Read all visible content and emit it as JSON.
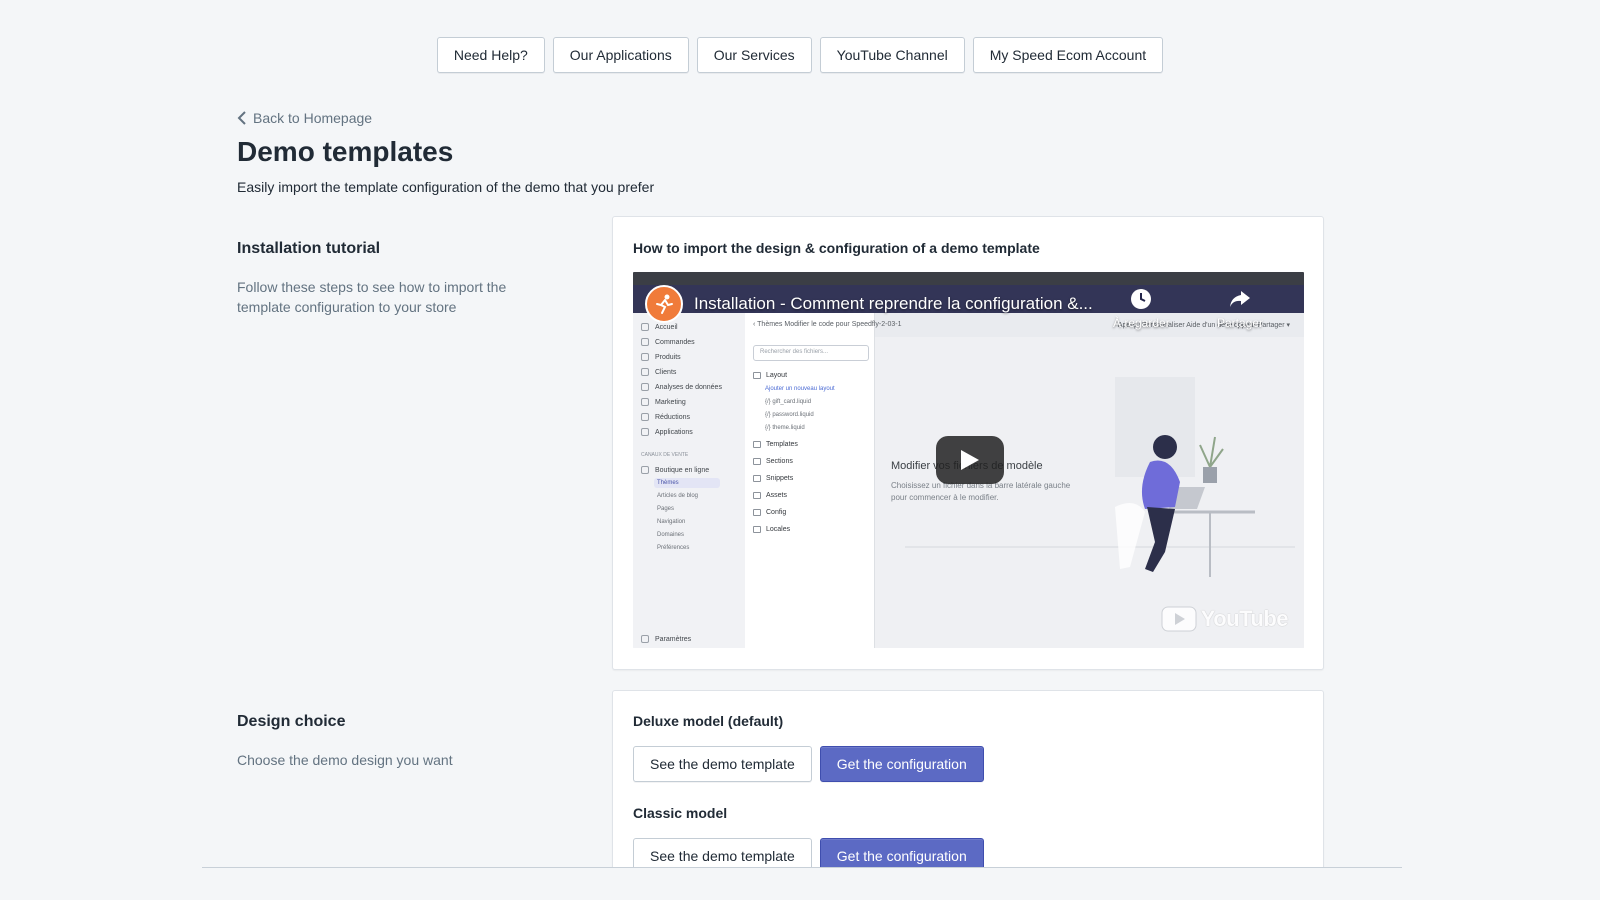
{
  "topnav": {
    "items": [
      "Need Help?",
      "Our Applications",
      "Our Services",
      "YouTube Channel",
      "My Speed Ecom Account"
    ]
  },
  "back": {
    "label": "Back to Homepage"
  },
  "page": {
    "title": "Demo templates",
    "subtitle": "Easily import the template configuration of the demo that you prefer"
  },
  "tutorial": {
    "title": "Installation tutorial",
    "description": "Follow these steps to see how to import the template configuration to your store",
    "card_title": "How to import the design & configuration of a demo template",
    "video": {
      "title": "Installation - Comment reprendre la configuration &...",
      "watch_later": "À regarder",
      "share": "Partager",
      "brand": "YouTube",
      "breadcrumb": "‹ Thèmes   Modifier le code pour Speedfly-2-03-1",
      "top_right": "Aperçu   Personnaliser   Aide d'un développeur   Partager ▾",
      "sidebar": [
        "Accueil",
        "Commandes",
        "Produits",
        "Clients",
        "Analyses de données",
        "Marketing",
        "Réductions",
        "Applications"
      ],
      "sales_channels": "CANAUX DE VENTE",
      "online_store": "Boutique en ligne",
      "online_store_items": [
        "Thèmes",
        "Articles de blog",
        "Pages",
        "Navigation",
        "Domaines",
        "Préférences"
      ],
      "settings": "Paramètres",
      "search_placeholder": "Rechercher des fichiers...",
      "layout_folder": "Layout",
      "layout_files": [
        "Ajouter un nouveau layout",
        "{/} gift_card.liquid",
        "{/} password.liquid",
        "{/} theme.liquid"
      ],
      "folders": [
        "Templates",
        "Sections",
        "Snippets",
        "Assets",
        "Config",
        "Locales"
      ],
      "main_heading": "Modifier vos fichiers de modèle",
      "main_desc": "Choisissez un fichier dans la barre latérale gauche pour commencer à le modifier."
    }
  },
  "design": {
    "title": "Design choice",
    "description": "Choose the demo design you want",
    "models": [
      {
        "label": "Deluxe model (default)",
        "demo_button": "See the demo template",
        "config_button": "Get the configuration"
      },
      {
        "label": "Classic model",
        "demo_button": "See the demo template",
        "config_button": "Get the configuration"
      }
    ]
  },
  "colors": {
    "primary": "#5c6ac4",
    "background": "#f4f6f8",
    "text_subdued": "#637381"
  }
}
